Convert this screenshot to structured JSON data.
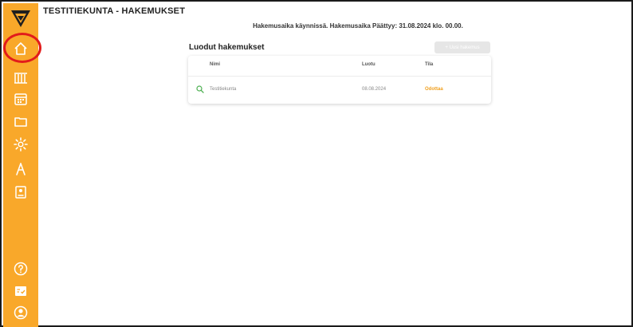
{
  "header": {
    "title": "TESTITIEKUNTA - HAKEMUKSET",
    "notice": "Hakemusaika käynnissä. Hakemusaika Päättyy: 31.08.2024 klo. 00.00."
  },
  "applications": {
    "section_title": "Luodut hakemukset",
    "new_button_label": "+ Uusi hakemus",
    "columns": [
      "Nimi",
      "Luotu",
      "Tila"
    ],
    "rows": [
      {
        "name": "Testitiekunta",
        "created": "08.08.2024",
        "status": "Odottaa"
      }
    ]
  },
  "sidebar": {
    "items": [
      {
        "icon": "home-icon",
        "active": true
      },
      {
        "icon": "bridge-icon"
      },
      {
        "icon": "calendar-icon"
      },
      {
        "icon": "folder-icon"
      },
      {
        "icon": "settings-icon"
      },
      {
        "icon": "compass-icon"
      },
      {
        "icon": "id-card-icon"
      },
      {
        "icon": "help-icon"
      },
      {
        "icon": "checklist-icon"
      },
      {
        "icon": "profile-icon"
      }
    ]
  },
  "colors": {
    "sidebar": "#f9a82a",
    "status_waiting": "#f0a020",
    "highlight": "#e21b1b"
  }
}
